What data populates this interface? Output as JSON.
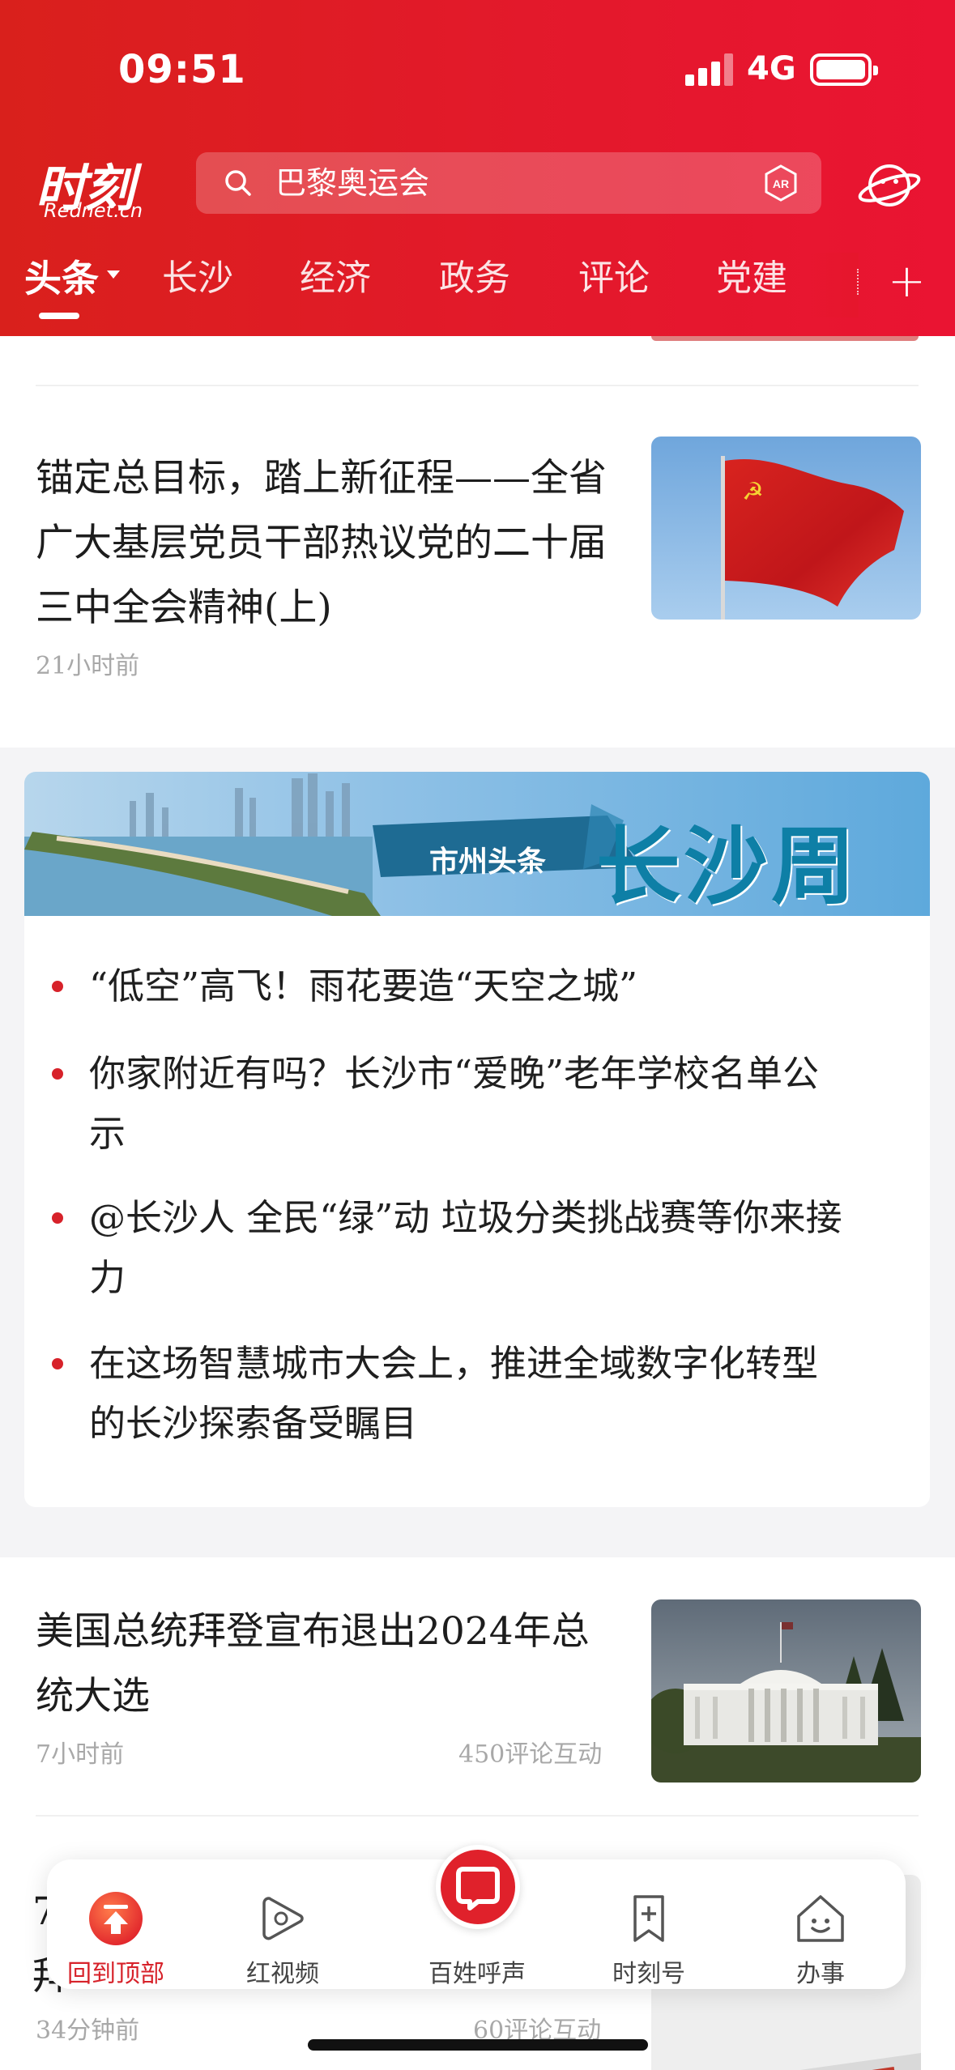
{
  "status_bar": {
    "time": "09:51",
    "network": "4G"
  },
  "header": {
    "logo_main": "时刻",
    "logo_sub": "Rednet.cn",
    "search_placeholder": "巴黎奥运会",
    "ar_label": "AR"
  },
  "tabs": [
    {
      "label": "头条",
      "active": true
    },
    {
      "label": "长沙"
    },
    {
      "label": "经济"
    },
    {
      "label": "政务"
    },
    {
      "label": "评论"
    },
    {
      "label": "党建"
    }
  ],
  "tab_add_label": "+",
  "articles": [
    {
      "title": "锚定总目标，踏上新征程——全省广大基层党员干部热议党的二十届三中全会精神(上)",
      "time": "21小时前",
      "image": "red-flag-photo"
    },
    {
      "title": "美国总统拜登宣布退出2024年总统大选",
      "time": "7小时前",
      "comments": "450评论互动",
      "image": "white-house-photo"
    },
    {
      "title_partial_1": "7",
      "title_partial_2": "拜",
      "time": "34分钟前",
      "comments": "60评论互动"
    }
  ],
  "feature": {
    "badge": "市州头条",
    "title": "长沙周",
    "items": [
      "“低空”高飞！雨花要造“天空之城”",
      "你家附近有吗？长沙市“爱晚”老年学校名单公示",
      "@长沙人  全民“绿”动  垃圾分类挑战赛等你来接力",
      "在这场智慧城市大会上，推进全域数字化转型的长沙探索备受瞩目"
    ]
  },
  "bottom_nav": [
    {
      "label": "回到顶部",
      "icon": "back-to-top-icon",
      "active": true
    },
    {
      "label": "红视频",
      "icon": "video-play-icon"
    },
    {
      "label": "百姓呼声",
      "icon": "message-icon"
    },
    {
      "label": "时刻号",
      "icon": "bookmark-add-icon"
    },
    {
      "label": "办事",
      "icon": "service-house-icon"
    }
  ],
  "colors": {
    "brand_red": "#e3192b",
    "accent_blue": "#0e7fa6"
  }
}
